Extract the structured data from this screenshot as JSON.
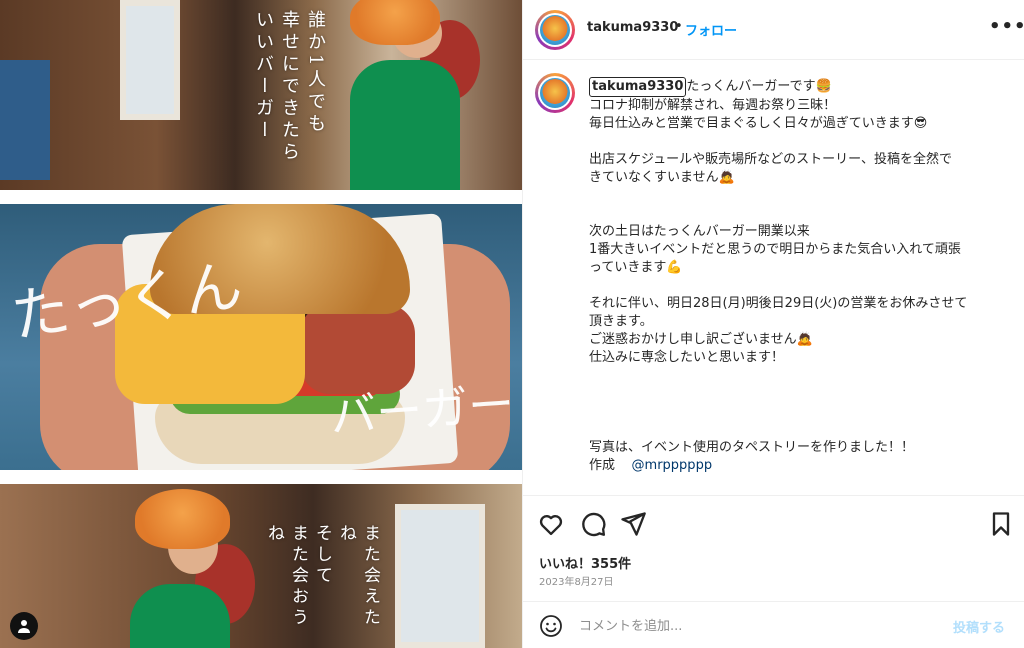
{
  "post": {
    "username": "takuma9330",
    "follow_label": "フォロー",
    "separator": "•",
    "more_label": "•••"
  },
  "image": {
    "top_text_lines": [
      "誰か1人でも",
      "幸せにできたら",
      "いいバーガー"
    ],
    "mid_script": [
      "たっくん",
      "バーガー"
    ],
    "bottom_text_lines": [
      "また会えたね",
      "そして",
      "また会おうね"
    ]
  },
  "caption": {
    "username": "takuma9330",
    "first_line": "たっくんバーガーです🍔",
    "lines": [
      "コロナ抑制が解禁され、毎週お祭り三昧！",
      "毎日仕込みと営業で目まぐるしく日々が過ぎていきます😎",
      "",
      "出店スケジュールや販売場所などのストーリー、投稿を全然で",
      "きていなくすいません🙇",
      "",
      "",
      "次の土日はたっくんバーガー開業以来",
      "1番大きいイベントだと思うので明日からまた気合い入れて頑張",
      "っていきます💪",
      "",
      "それに伴い、明日28日(月)明後日29日(火)の営業をお休みさせて",
      "頂きます。",
      "ご迷惑おかけし申し訳ございません🙇",
      "仕込みに専念したいと思います！",
      "",
      "",
      "",
      "",
      "写真は、イベント使用のタペストリーを作りました！！"
    ],
    "credit_label": "作成",
    "credit_mention": "@mrpppppp"
  },
  "actions": {
    "likes": "いいね！355件",
    "date": "2023年8月27日"
  },
  "comment": {
    "placeholder": "コメントを追加...",
    "post_label": "投稿する"
  },
  "colors": {
    "accent": "#0095f6",
    "post_disabled": "#b2dffc",
    "shirt": "#0f8f4f"
  }
}
